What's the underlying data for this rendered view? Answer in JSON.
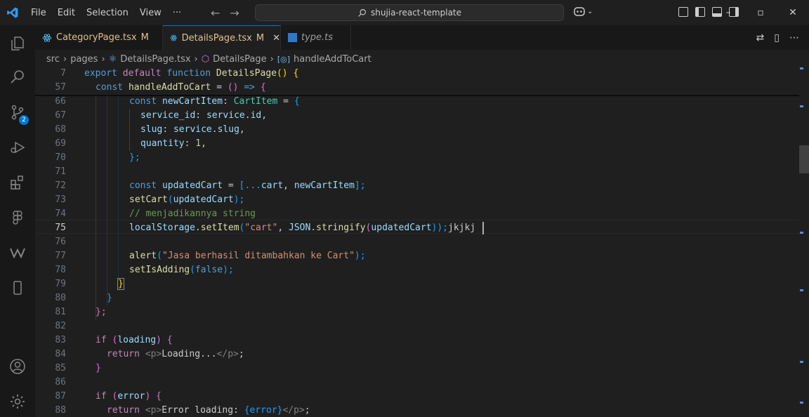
{
  "menu": {
    "file": "File",
    "edit": "Edit",
    "selection": "Selection",
    "view": "View",
    "more": "···"
  },
  "search": {
    "text": "shujia-react-template"
  },
  "tabs": [
    {
      "label": "CategoryPage.tsx",
      "status": "M"
    },
    {
      "label": "DetailsPage.tsx",
      "status": "M"
    },
    {
      "label": "type.ts",
      "status": ""
    }
  ],
  "breadcrumbs": {
    "src": "src",
    "pages": "pages",
    "file": "DetailsPage.tsx",
    "component": "DetailsPage",
    "method": "handleAddToCart"
  },
  "scm_badge": "2",
  "colors": {
    "accent": "#0078d4",
    "modified": "#e2c08d"
  },
  "lines": [
    {
      "n": "7"
    },
    {
      "n": "57"
    },
    {
      "n": "66"
    },
    {
      "n": "67"
    },
    {
      "n": "68"
    },
    {
      "n": "69"
    },
    {
      "n": "70"
    },
    {
      "n": "71"
    },
    {
      "n": "72"
    },
    {
      "n": "73"
    },
    {
      "n": "74"
    },
    {
      "n": "75"
    },
    {
      "n": "76"
    },
    {
      "n": "77"
    },
    {
      "n": "78"
    },
    {
      "n": "79"
    },
    {
      "n": "80"
    },
    {
      "n": "81"
    },
    {
      "n": "82"
    },
    {
      "n": "83"
    },
    {
      "n": "84"
    },
    {
      "n": "85"
    },
    {
      "n": "86"
    },
    {
      "n": "87"
    },
    {
      "n": "88"
    }
  ],
  "code": {
    "l7": [
      "export",
      "default",
      "function",
      "DetailsPage",
      "()",
      "{"
    ],
    "l57": [
      "const",
      "handleAddToCart",
      "=",
      "()",
      "=>",
      "{"
    ],
    "l66": [
      "const",
      "newCartItem",
      ":",
      "CartItem",
      "=",
      "{"
    ],
    "l67": [
      "service_id",
      ":",
      "service",
      ".",
      "id",
      ","
    ],
    "l68": [
      "slug",
      ":",
      "service",
      ".",
      "slug",
      ","
    ],
    "l69": [
      "quantity",
      ":",
      "1",
      ","
    ],
    "l70": [
      "};"
    ],
    "l72": [
      "const",
      "updatedCart",
      "=",
      "[...",
      "cart",
      ",",
      "newCartItem",
      "];"
    ],
    "l73": [
      "setCart",
      "(",
      "updatedCart",
      ");"
    ],
    "l74": [
      "// menjadikannya string"
    ],
    "l75": [
      "localStorage",
      ".",
      "setItem",
      "(",
      "\"cart\"",
      ",",
      "JSON",
      ".",
      "stringify",
      "(",
      "updatedCart",
      "));",
      "jkjkj"
    ],
    "l77": [
      "alert",
      "(",
      "\"Jasa berhasil ditambahkan ke Cart\"",
      ");"
    ],
    "l78": [
      "setIsAdding",
      "(",
      "false",
      ");"
    ],
    "l79": [
      "}"
    ],
    "l80": [
      "}"
    ],
    "l81": [
      "};"
    ],
    "l83": [
      "if",
      "(",
      "loading",
      ")",
      "{"
    ],
    "l84": [
      "return",
      "<p>",
      "Loading...",
      "</p>",
      ";"
    ],
    "l85": [
      "}"
    ],
    "l87": [
      "if",
      "(",
      "error",
      ")",
      "{"
    ],
    "l88": [
      "return",
      "<p>",
      "Error loading: ",
      "{error}",
      "</p>",
      ";"
    ]
  }
}
